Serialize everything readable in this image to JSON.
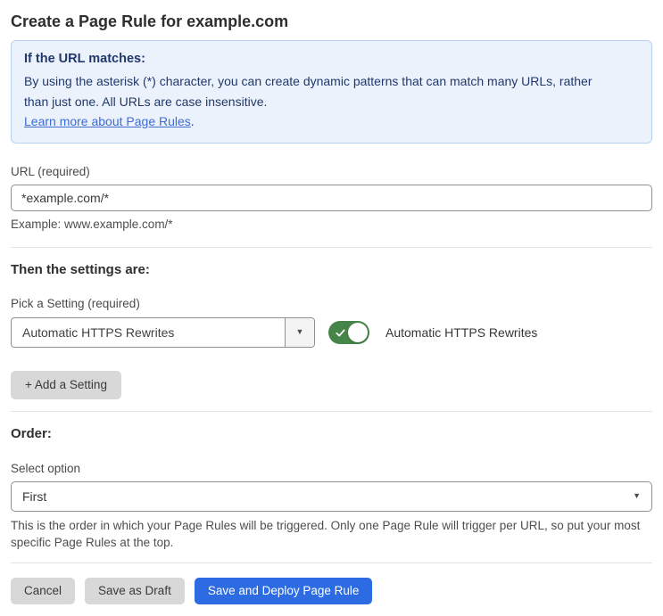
{
  "page": {
    "title": "Create a Page Rule for example.com"
  },
  "info_box": {
    "heading": "If the URL matches:",
    "body": "By using the asterisk (*) character, you can create dynamic patterns that can match many URLs, rather than just one. All URLs are case insensitive.",
    "link": "Learn more about Page Rules",
    "link_suffix": "."
  },
  "url_field": {
    "label": "URL (required)",
    "value": "*example.com/*",
    "helper": "Example: www.example.com/*"
  },
  "settings_section": {
    "heading": "Then the settings are:",
    "picker_label": "Pick a Setting (required)",
    "selected_setting": "Automatic HTTPS Rewrites",
    "toggle": {
      "state": "on",
      "label": "Automatic HTTPS Rewrites"
    },
    "add_setting_label": "+ Add a Setting"
  },
  "order_section": {
    "heading": "Order:",
    "select_label": "Select option",
    "selected_option": "First",
    "helper": "This is the order in which your Page Rules will be triggered. Only one Page Rule will trigger per URL, so put your most specific Page Rules at the top."
  },
  "footer": {
    "cancel_label": "Cancel",
    "save_draft_label": "Save as Draft",
    "save_deploy_label": "Save and Deploy Page Rule"
  },
  "icons": {
    "dropdown_caret": "▼",
    "select_caret": "▼"
  },
  "colors": {
    "accent_blue": "#2d6be3",
    "toggle_green": "#46854a",
    "info_bg": "#ebf2fc",
    "info_border": "#b9d0f0",
    "info_text": "#21386b",
    "link_blue": "#3e6cd3",
    "button_gray": "#d8d8d8",
    "divider": "#e4e4e4"
  }
}
